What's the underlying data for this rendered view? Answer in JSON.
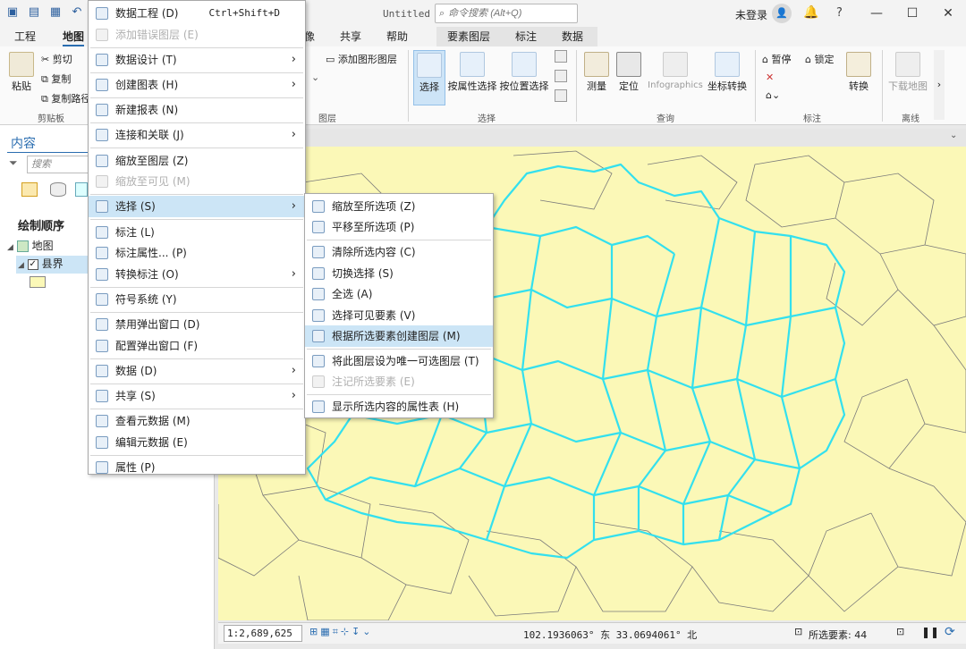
{
  "title_bar": {
    "window_title": "Untitled",
    "search_placeholder": "命令搜索 (Alt+Q)",
    "login": "未登录",
    "help": "?"
  },
  "tabs": [
    "工程",
    "地图",
    "像",
    "共享",
    "帮助"
  ],
  "context_tabs": [
    "要素图层",
    "标注",
    "数据"
  ],
  "ribbon": {
    "clipboard": {
      "paste": "粘贴",
      "cut": "剪切",
      "copy": "复制",
      "copy_path": "复制路径",
      "label": "剪贴板"
    },
    "layer": {
      "add_graphics": "添加图形图层",
      "label": "图层"
    },
    "selection": {
      "select": "选择",
      "by_attr": "按属性选择",
      "by_loc": "按位置选择",
      "label": "选择"
    },
    "inquiry": {
      "measure": "测量",
      "locate": "定位",
      "infographics": "Infographics",
      "convert_coords": "坐标转换",
      "label": "查询"
    },
    "labeling": {
      "pause": "暂停",
      "lock": "锁定",
      "convert": "转换",
      "label": "标注"
    },
    "offline": {
      "download": "下载地图",
      "label": "离线"
    }
  },
  "contents_panel": {
    "title": "内容",
    "search_placeholder": "搜索",
    "draw_order": "绘制顺序",
    "map_node": "地图",
    "layer_node": "县界"
  },
  "context_menu": [
    {
      "label": "数据工程 (D)",
      "shortcut": "Ctrl+Shift+D",
      "enabled": true
    },
    {
      "label": "添加错误图层 (E)",
      "enabled": false
    },
    {
      "sep": true
    },
    {
      "label": "数据设计 (T)",
      "submenu": true,
      "enabled": true
    },
    {
      "sep": true
    },
    {
      "label": "创建图表 (H)",
      "submenu": true,
      "enabled": true
    },
    {
      "sep": true
    },
    {
      "label": "新建报表 (N)",
      "enabled": true
    },
    {
      "sep": true
    },
    {
      "label": "连接和关联 (J)",
      "submenu": true,
      "enabled": true
    },
    {
      "sep": true
    },
    {
      "label": "缩放至图层 (Z)",
      "enabled": true
    },
    {
      "label": "缩放至可见 (M)",
      "enabled": false
    },
    {
      "sep": true
    },
    {
      "label": "选择 (S)",
      "submenu": true,
      "enabled": true,
      "highlighted": true
    },
    {
      "sep": true
    },
    {
      "label": "标注 (L)",
      "enabled": true
    },
    {
      "label": "标注属性... (P)",
      "enabled": true
    },
    {
      "label": "转换标注 (O)",
      "submenu": true,
      "enabled": true
    },
    {
      "sep": true
    },
    {
      "label": "符号系统 (Y)",
      "enabled": true
    },
    {
      "sep": true
    },
    {
      "label": "禁用弹出窗口 (D)",
      "enabled": true
    },
    {
      "label": "配置弹出窗口 (F)",
      "enabled": true
    },
    {
      "sep": true
    },
    {
      "label": "数据 (D)",
      "submenu": true,
      "enabled": true
    },
    {
      "sep": true
    },
    {
      "label": "共享 (S)",
      "submenu": true,
      "enabled": true
    },
    {
      "sep": true
    },
    {
      "label": "查看元数据 (M)",
      "enabled": true
    },
    {
      "label": "编辑元数据 (E)",
      "enabled": true
    },
    {
      "sep": true
    },
    {
      "label": "属性 (P)",
      "enabled": true
    }
  ],
  "submenu": [
    {
      "label": "缩放至所选项 (Z)",
      "enabled": true
    },
    {
      "label": "平移至所选项 (P)",
      "enabled": true
    },
    {
      "sep": true
    },
    {
      "label": "清除所选内容 (C)",
      "enabled": true
    },
    {
      "label": "切换选择 (S)",
      "enabled": true
    },
    {
      "label": "全选 (A)",
      "enabled": true
    },
    {
      "label": "选择可见要素 (V)",
      "enabled": true
    },
    {
      "label": "根据所选要素创建图层 (M)",
      "enabled": true,
      "highlighted": true
    },
    {
      "sep": true
    },
    {
      "label": "将此图层设为唯一可选图层 (T)",
      "enabled": true
    },
    {
      "label": "注记所选要素 (E)",
      "enabled": false
    },
    {
      "sep": true
    },
    {
      "label": "显示所选内容的属性表 (H)",
      "enabled": true
    }
  ],
  "status": {
    "scale": "1:2,689,625",
    "coords": "102.1936063° 东 33.0694061° 北",
    "selected": "所选要素: 44"
  },
  "colors": {
    "map_fill": "#fbf8b7",
    "selection": "#33e0ee",
    "boundary": "#7a7a7a",
    "accent": "#2a6db0"
  }
}
